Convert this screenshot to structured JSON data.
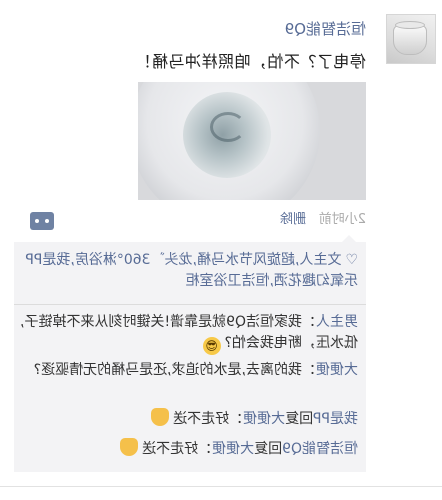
{
  "post": {
    "user_name": "恒洁智能Q9",
    "text": "停电了？不怕，咱照样冲马桶！",
    "time": "2小时前",
    "delete_label": "删除"
  },
  "likes": {
    "heart_icon": "heart-icon",
    "names": "文主人,超旋风节水马桶,龙头゛360°淋浴房,我是PP乐氧幻趣花洒,恒洁卫浴室柜"
  },
  "comments": [
    {
      "who": "男主人",
      "sep": "：",
      "text": "我家恒洁Q9就是靠谱!关键时刻从来不掉链子,低水压，断电我会怕?",
      "emoji": "cool-face"
    },
    {
      "who": "大便便",
      "sep": "：",
      "text": "我的离去,是水的追求,还是马桶的无情驱逐?"
    },
    {
      "who": "我是PP",
      "mid": "回复",
      "who2": "大便便",
      "sep": "：",
      "text": "好走不送",
      "emoji": "wave-hand"
    },
    {
      "who": "恒洁智能Q9",
      "mid": "回复",
      "who2": "大便便",
      "sep": "：",
      "text": "好走不送",
      "emoji": "wave-hand"
    }
  ],
  "colors": {
    "link": "#576b95",
    "box_bg": "#f3f3f5",
    "comment_button": "#6f82a3"
  }
}
